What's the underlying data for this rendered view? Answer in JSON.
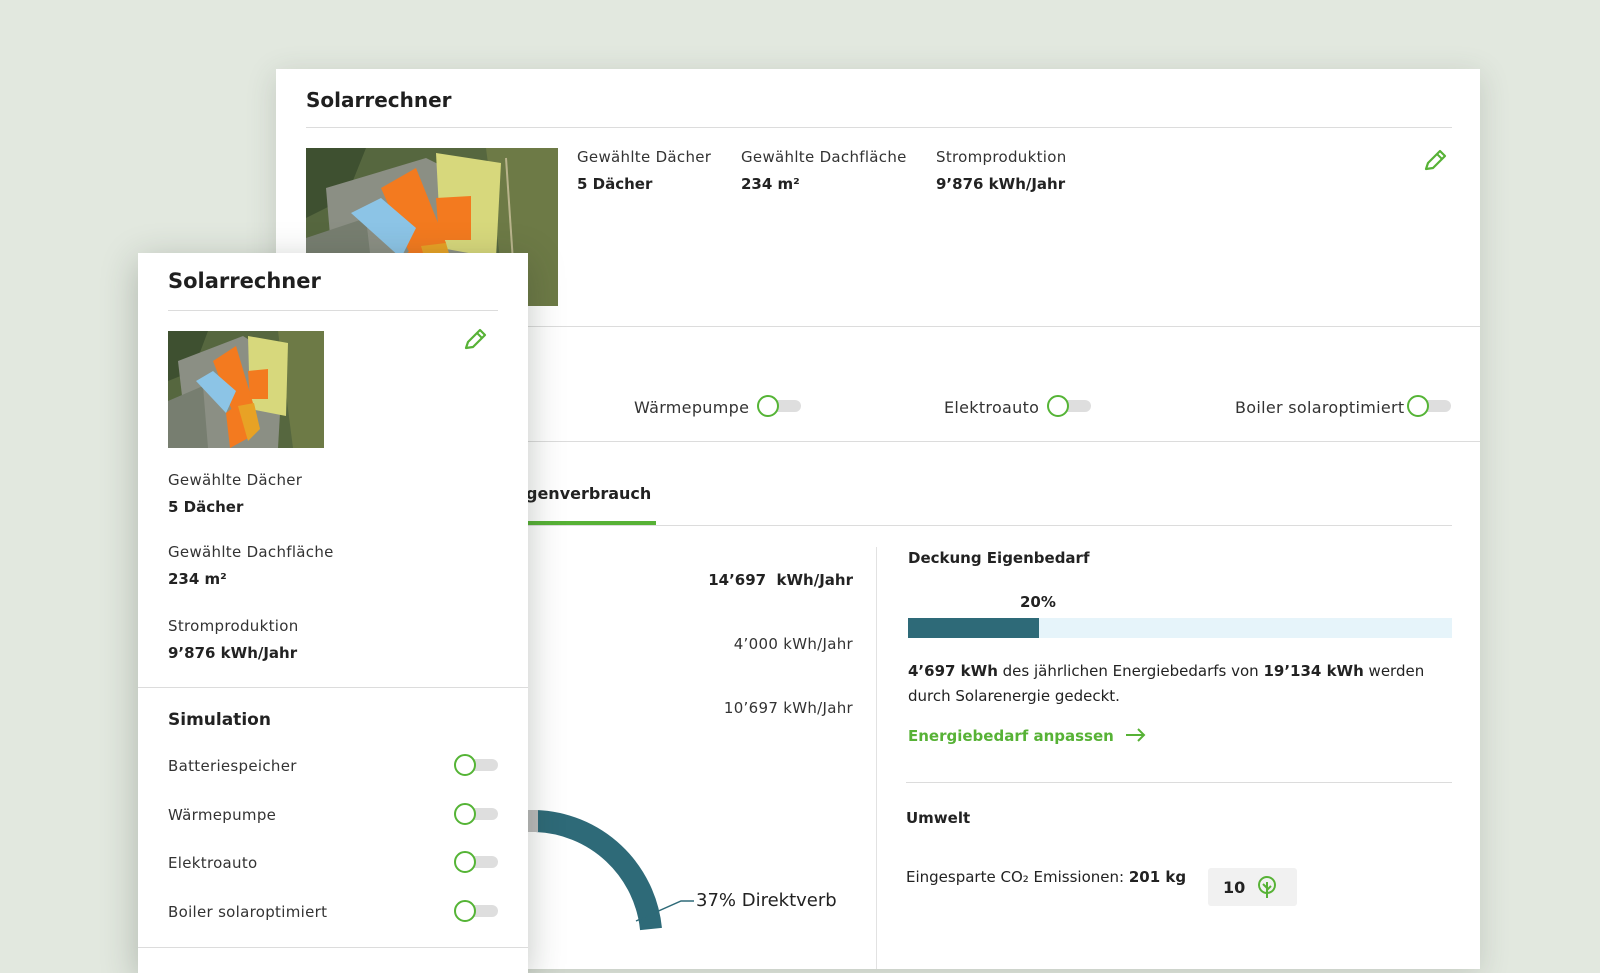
{
  "back_card": {
    "title": "Solarrechner",
    "stats": [
      {
        "label": "Gewählte Dächer",
        "value": "5 Dächer"
      },
      {
        "label": "Gewählte Dachfläche",
        "value": "234 m²"
      },
      {
        "label": "Stromproduktion",
        "value": "9’876 kWh/Jahr"
      }
    ],
    "toggles": [
      {
        "label": "Wärmepumpe"
      },
      {
        "label": "Elektroauto"
      },
      {
        "label": "Boiler solaroptimiert"
      }
    ],
    "tab_label": "genverbrauch",
    "rows": [
      {
        "value": "14’697  kWh/Jahr"
      },
      {
        "value": "4’000 kWh/Jahr"
      },
      {
        "value": "10’697 kWh/Jahr"
      }
    ],
    "donut_label": "37% Direktverb",
    "deckung": {
      "title": "Deckung Eigenbedarf",
      "percent_text": "20%",
      "percent": 0.24,
      "text_a": "4’697 kWh",
      "text_b": " des jährlichen Energiebedarfs von ",
      "text_c": "19’134 kWh",
      "text_d": " werden",
      "text_e": "durch Solarenergie gedeckt.",
      "link": "Energiebedarf anpassen"
    },
    "umwelt": {
      "title": "Umwelt",
      "label": "Eingesparte CO₂ Emissionen: ",
      "value": "201 kg",
      "trees": "10"
    }
  },
  "front_card": {
    "title": "Solarrechner",
    "stats": [
      {
        "label": "Gewählte Dächer",
        "value": "5 Dächer"
      },
      {
        "label": "Gewählte Dachfläche",
        "value": "234 m²"
      },
      {
        "label": "Stromproduktion",
        "value": "9’876 kWh/Jahr"
      }
    ],
    "simulation_title": "Simulation",
    "toggles": [
      {
        "label": "Batteriespeicher"
      },
      {
        "label": "Wärmepumpe"
      },
      {
        "label": "Elektroauto"
      },
      {
        "label": "Boiler solaroptimiert"
      }
    ]
  },
  "colors": {
    "accent": "#57b236",
    "bar": "#2e6a78",
    "bar_track": "#e6f4fa",
    "roof_orange": "#f37a1f",
    "roof_blue": "#8cc4e6",
    "roof_yellow": "#d8d87a"
  }
}
